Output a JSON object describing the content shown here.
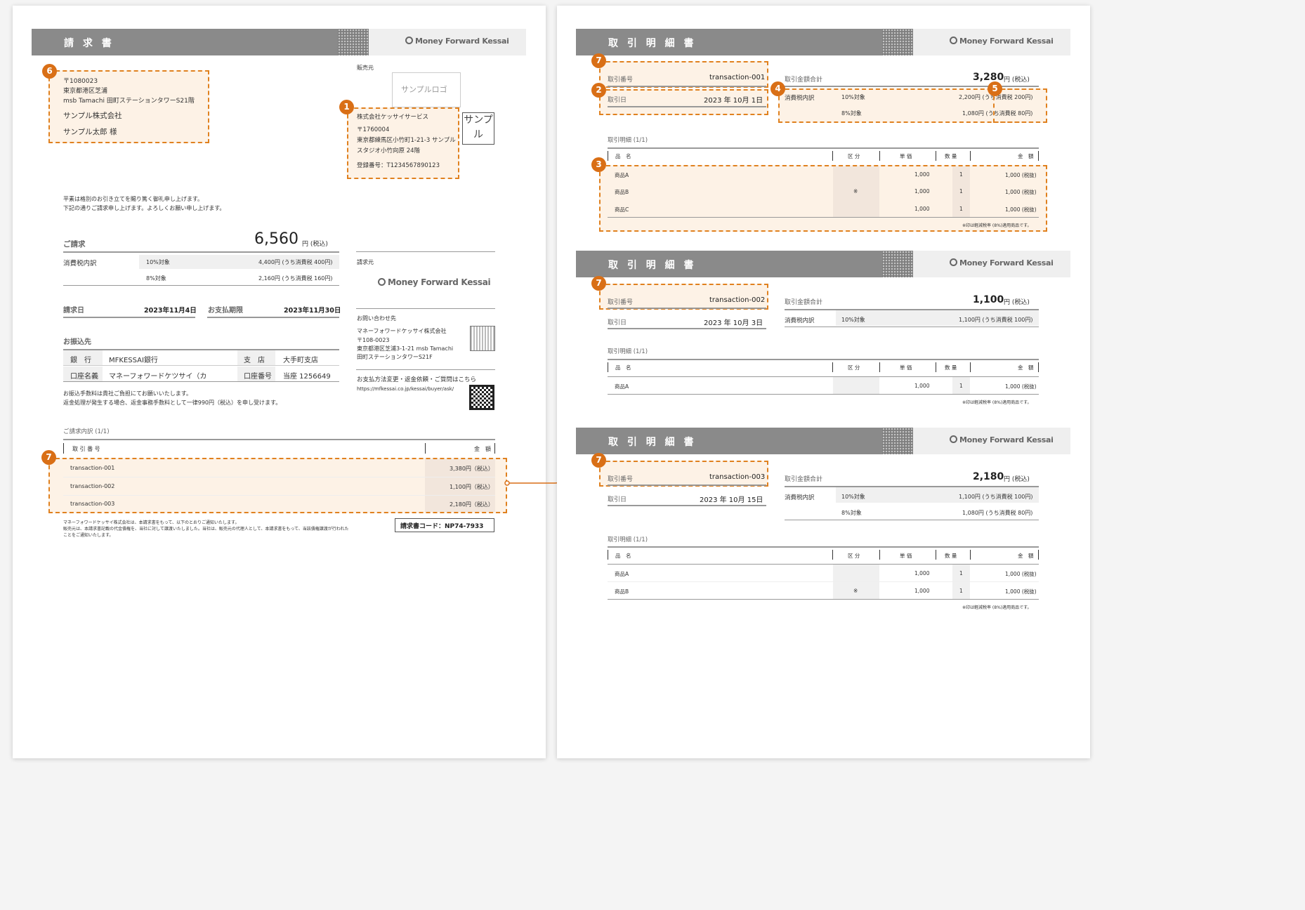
{
  "brand": "Money Forward Kessai",
  "colors": {
    "accent": "#d96f16",
    "header": "#8a8a8a"
  },
  "invoice": {
    "title": "請 求 書",
    "recipient": {
      "zip": "〒1080023",
      "addr1": "東京都港区芝浦",
      "addr2": "msb Tamachi 田町ステーションタワーS21階",
      "company": "サンプル株式会社",
      "person": "サンプル太郎 様"
    },
    "seller": {
      "label": "販売元",
      "logo": "サンプルロゴ",
      "name": "株式会社ケッサイサービス",
      "zip": "〒1760004",
      "addr1": "東京都練馬区小竹町1-21-3 サンプル",
      "addr2": "スタジオ小竹向原 24階",
      "reg": "登録番号：T1234567890123",
      "stamp": "サンプル"
    },
    "greeting1": "平素は格別のお引き立てを賜り篤く御礼申し上げます。",
    "greeting2": "下記の通りご請求申し上げます。よろしくお願い申し上げます。",
    "amount_label": "ご請求",
    "amount": "6,560",
    "amount_unit": "円 (税込)",
    "tax_label": "消費税内訳",
    "tax_rows": [
      {
        "rate": "10%対象",
        "value": "4,400円 (うち消費税 400円)"
      },
      {
        "rate": "8%対象",
        "value": "2,160円 (うち消費税 160円)"
      }
    ],
    "issue_label": "請求日",
    "issue_date": "2023年11月4日",
    "due_label": "お支払期限",
    "due_date": "2023年11月30日",
    "bank_section": "お振込先",
    "bank": {
      "bank_label": "銀　行",
      "bank": "MFKESSAI銀行",
      "branch_label": "支　店",
      "branch": "大手町支店",
      "holder_label": "口座名義",
      "holder": "マネーフォワードケツサイ（カ",
      "number_label": "口座番号",
      "number": "当座 1256649"
    },
    "note1": "お振込手数料は貴社ご負担にてお願いいたします。",
    "note2": "返金処理が発生する場合、返金事務手数料として一律990円（税込）を申し受けます。",
    "billed_by_label": "請求元",
    "contact_label": "お問い合わせ先",
    "contact": {
      "name": "マネーフォワードケッサイ株式会社",
      "zip": "〒108-0023",
      "addr1": "東京都港区芝浦3-1-21 msb Tamachi",
      "addr2": "田町ステーションタワーS21F"
    },
    "pay_change": "お支払方法変更・返金依頼・ご質問はこちら",
    "url": "https://mfkessai.co.jp/kessai/buyer/ask/",
    "detail_title": "ご請求内訳 (1/1)",
    "detail_head": {
      "id": "取 引 番 号",
      "amount": "金　額"
    },
    "detail_rows": [
      {
        "id": "transaction-001",
        "amount": "3,380円（税込）"
      },
      {
        "id": "transaction-002",
        "amount": "1,100円（税込）"
      },
      {
        "id": "transaction-003",
        "amount": "2,180円（税込）"
      }
    ],
    "footer1": "マネーフォワードケッサイ株式会社は、本請求書をもって、以下のとおりご通知いたします。",
    "footer2": "販売元は、本請求書記載の代金債権を、当社に対して譲渡いたしました。当社は、販売元の代理人として、本請求書をもって、当該債権譲渡が行われた",
    "footer3": "ことをご通知いたします。",
    "code": "請求書コード：NP74-7933"
  },
  "statements": [
    {
      "title": "取 引 明 細 書",
      "id_label": "取引番号",
      "id": "transaction-001",
      "date_label": "取引日",
      "date": "2023 年 10月 1日",
      "total_label": "取引金額合計",
      "total": "3,280",
      "unit": "円 (税込)",
      "tax_label": "消費税内訳",
      "tax_rows": [
        {
          "rate": "10%対象",
          "value": "2,200円 (うち消費税 200円)"
        },
        {
          "rate": "8%対象",
          "value": "1,080円 (うち消費税 80円)"
        }
      ],
      "detail_title": "取引明細 (1/1)",
      "head": {
        "name": "品　名",
        "cat": "区 分",
        "price": "単 価",
        "qty": "数 量",
        "amount": "金　額"
      },
      "items": [
        {
          "name": "商品A",
          "cat": "",
          "price": "1,000",
          "qty": "1",
          "amount": "1,000 (税抜)"
        },
        {
          "name": "商品B",
          "cat": "※",
          "price": "1,000",
          "qty": "1",
          "amount": "1,000 (税抜)"
        },
        {
          "name": "商品C",
          "cat": "",
          "price": "1,000",
          "qty": "1",
          "amount": "1,000 (税抜)"
        }
      ],
      "note": "※印は軽減税率 (8%)適用商品です。"
    },
    {
      "title": "取 引 明 細 書",
      "id_label": "取引番号",
      "id": "transaction-002",
      "date_label": "取引日",
      "date": "2023 年 10月 3日",
      "total_label": "取引金額合計",
      "total": "1,100",
      "unit": "円 (税込)",
      "tax_label": "消費税内訳",
      "tax_rows": [
        {
          "rate": "10%対象",
          "value": "1,100円 (うち消費税 100円)"
        }
      ],
      "detail_title": "取引明細 (1/1)",
      "head": {
        "name": "品　名",
        "cat": "区 分",
        "price": "単 価",
        "qty": "数 量",
        "amount": "金　額"
      },
      "items": [
        {
          "name": "商品A",
          "cat": "",
          "price": "1,000",
          "qty": "1",
          "amount": "1,000 (税抜)"
        }
      ],
      "note": "※印は軽減税率 (8%)適用商品です。"
    },
    {
      "title": "取 引 明 細 書",
      "id_label": "取引番号",
      "id": "transaction-003",
      "date_label": "取引日",
      "date": "2023 年 10月 15日",
      "total_label": "取引金額合計",
      "total": "2,180",
      "unit": "円 (税込)",
      "tax_label": "消費税内訳",
      "tax_rows": [
        {
          "rate": "10%対象",
          "value": "1,100円 (うち消費税 100円)"
        },
        {
          "rate": "8%対象",
          "value": "1,080円 (うち消費税 80円)"
        }
      ],
      "detail_title": "取引明細 (1/1)",
      "head": {
        "name": "品　名",
        "cat": "区 分",
        "price": "単 価",
        "qty": "数 量",
        "amount": "金　額"
      },
      "items": [
        {
          "name": "商品A",
          "cat": "",
          "price": "1,000",
          "qty": "1",
          "amount": "1,000 (税抜)"
        },
        {
          "name": "商品B",
          "cat": "※",
          "price": "1,000",
          "qty": "1",
          "amount": "1,000 (税抜)"
        }
      ],
      "note": "※印は軽減税率 (8%)適用商品です。"
    }
  ],
  "badges": [
    "1",
    "2",
    "3",
    "4",
    "5",
    "6",
    "7"
  ]
}
